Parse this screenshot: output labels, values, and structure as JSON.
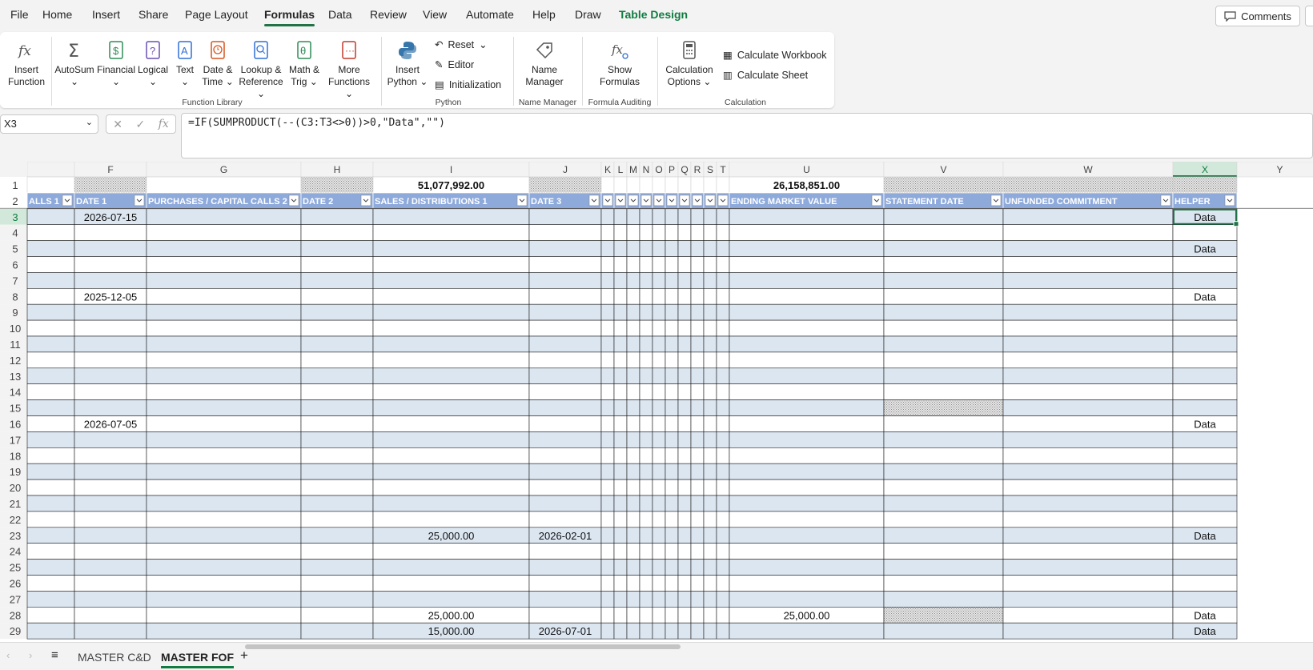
{
  "menu": [
    "File",
    "Home",
    "Insert",
    "Share",
    "Page Layout",
    "Formulas",
    "Data",
    "Review",
    "View",
    "Automate",
    "Help",
    "Draw",
    "Table Design"
  ],
  "active_menu": "Formulas",
  "comments_label": "Comments",
  "ribbon": {
    "insert_function": [
      "Insert",
      "Function"
    ],
    "autosum": "AutoSum",
    "financial": "Financial",
    "logical": "Logical",
    "text": "Text",
    "date_time": [
      "Date &",
      "Time"
    ],
    "lookup": [
      "Lookup &",
      "Reference"
    ],
    "math": [
      "Math &",
      "Trig"
    ],
    "more": [
      "More",
      "Functions"
    ],
    "function_library": "Function Library",
    "insert_python": [
      "Insert",
      "Python"
    ],
    "reset": "Reset",
    "editor": "Editor",
    "initialization": "Initialization",
    "python": "Python",
    "name_manager": [
      "Name",
      "Manager"
    ],
    "name_manager_group": "Name Manager",
    "show_formulas": [
      "Show",
      "Formulas"
    ],
    "formula_auditing": "Formula Auditing",
    "calc_options": [
      "Calculation",
      "Options"
    ],
    "calc_workbook": "Calculate Workbook",
    "calc_sheet": "Calculate Sheet",
    "calculation": "Calculation"
  },
  "name_box": "X3",
  "formula": "=IF(SUMPRODUCT(--(C3:T3<>0))>0,\"Data\",\"\")",
  "grid": {
    "columns": [
      {
        "letter": "",
        "header": "ALLS 1",
        "w": 59
      },
      {
        "letter": "F",
        "header": "DATE 1",
        "w": 90
      },
      {
        "letter": "G",
        "header": "PURCHASES / CAPITAL CALLS 2",
        "w": 193
      },
      {
        "letter": "H",
        "header": "DATE 2",
        "w": 90
      },
      {
        "letter": "I",
        "header": "SALES / DISTRIBUTIONS 1",
        "w": 195
      },
      {
        "letter": "J",
        "header": "DATE 3",
        "w": 90
      },
      {
        "letter": "K",
        "header": "",
        "w": 16
      },
      {
        "letter": "L",
        "header": "",
        "w": 16
      },
      {
        "letter": "M",
        "header": "",
        "w": 16
      },
      {
        "letter": "N",
        "header": "",
        "w": 16
      },
      {
        "letter": "O",
        "header": "",
        "w": 16
      },
      {
        "letter": "P",
        "header": "",
        "w": 16
      },
      {
        "letter": "Q",
        "header": "",
        "w": 16
      },
      {
        "letter": "R",
        "header": "",
        "w": 16
      },
      {
        "letter": "S",
        "header": "",
        "w": 16
      },
      {
        "letter": "T",
        "header": "",
        "w": 16
      },
      {
        "letter": "U",
        "header": "ENDING MARKET VALUE",
        "w": 193
      },
      {
        "letter": "V",
        "header": "STATEMENT DATE",
        "w": 149
      },
      {
        "letter": "W",
        "header": "UNFUNDED COMMITMENT",
        "w": 212
      },
      {
        "letter": "X",
        "header": "HELPER",
        "w": 80
      },
      {
        "letter": "Y",
        "header": "",
        "w": 107
      }
    ],
    "row1": {
      "I": "51,077,992.00",
      "U": "26,158,851.00"
    },
    "rows": [
      {
        "n": "3",
        "F": "2026-07-15",
        "X": "Data"
      },
      {
        "n": "4"
      },
      {
        "n": "5",
        "X": "Data"
      },
      {
        "n": "6"
      },
      {
        "n": "7"
      },
      {
        "n": "8",
        "F": "2025-12-05",
        "X": "Data"
      },
      {
        "n": "9"
      },
      {
        "n": "10"
      },
      {
        "n": "11"
      },
      {
        "n": "12"
      },
      {
        "n": "13"
      },
      {
        "n": "14"
      },
      {
        "n": "15"
      },
      {
        "n": "16",
        "F": "2026-07-05",
        "X": "Data"
      },
      {
        "n": "17"
      },
      {
        "n": "18"
      },
      {
        "n": "19"
      },
      {
        "n": "20"
      },
      {
        "n": "21"
      },
      {
        "n": "22"
      },
      {
        "n": "23",
        "I": "25,000.00",
        "J": "2026-02-01",
        "X": "Data"
      },
      {
        "n": "24"
      },
      {
        "n": "25"
      },
      {
        "n": "26"
      },
      {
        "n": "27"
      },
      {
        "n": "28",
        "I": "25,000.00",
        "U": "25,000.00",
        "X": "Data"
      },
      {
        "n": "29",
        "I": "15,000.00",
        "J": "2026-07-01",
        "X": "Data"
      }
    ]
  },
  "sheets": [
    "MASTER C&D",
    "MASTER FOF"
  ],
  "active_sheet": "MASTER FOF",
  "colors": {
    "accent": "#107c41",
    "band": "#dce6f1",
    "header_fill": "#8eaadb",
    "selected": "#217346"
  }
}
